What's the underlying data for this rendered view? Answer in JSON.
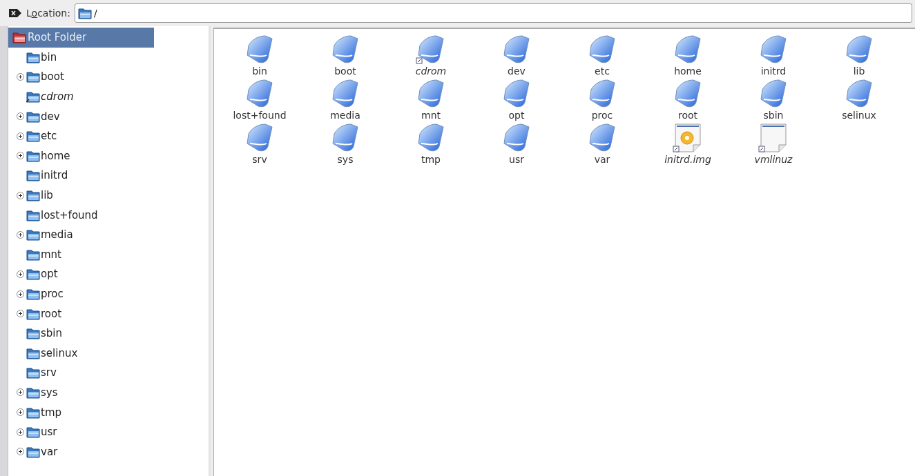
{
  "location_bar": {
    "label": [
      {
        "text": "L",
        "underlined": false
      },
      {
        "text": "o",
        "underlined": true
      },
      {
        "text": "cation:",
        "underlined": false
      }
    ],
    "value": "/"
  },
  "tree": {
    "root": {
      "label": "Root Folder",
      "selected": true,
      "children": [
        {
          "label": "bin",
          "expandable": false,
          "link": false
        },
        {
          "label": "boot",
          "expandable": true,
          "link": false
        },
        {
          "label": "cdrom",
          "expandable": false,
          "link": true
        },
        {
          "label": "dev",
          "expandable": true,
          "link": false
        },
        {
          "label": "etc",
          "expandable": true,
          "link": false
        },
        {
          "label": "home",
          "expandable": true,
          "link": false
        },
        {
          "label": "initrd",
          "expandable": false,
          "link": false
        },
        {
          "label": "lib",
          "expandable": true,
          "link": false
        },
        {
          "label": "lost+found",
          "expandable": false,
          "link": false
        },
        {
          "label": "media",
          "expandable": true,
          "link": false
        },
        {
          "label": "mnt",
          "expandable": false,
          "link": false
        },
        {
          "label": "opt",
          "expandable": true,
          "link": false
        },
        {
          "label": "proc",
          "expandable": true,
          "link": false
        },
        {
          "label": "root",
          "expandable": true,
          "link": false
        },
        {
          "label": "sbin",
          "expandable": false,
          "link": false
        },
        {
          "label": "selinux",
          "expandable": false,
          "link": false
        },
        {
          "label": "srv",
          "expandable": false,
          "link": false
        },
        {
          "label": "sys",
          "expandable": true,
          "link": false
        },
        {
          "label": "tmp",
          "expandable": true,
          "link": false
        },
        {
          "label": "usr",
          "expandable": true,
          "link": false
        },
        {
          "label": "var",
          "expandable": true,
          "link": false
        }
      ]
    }
  },
  "files": [
    {
      "name": "bin",
      "kind": "folder",
      "link": false
    },
    {
      "name": "boot",
      "kind": "folder",
      "link": false
    },
    {
      "name": "cdrom",
      "kind": "folder",
      "link": true
    },
    {
      "name": "dev",
      "kind": "folder",
      "link": false
    },
    {
      "name": "etc",
      "kind": "folder",
      "link": false
    },
    {
      "name": "home",
      "kind": "folder",
      "link": false
    },
    {
      "name": "initrd",
      "kind": "folder",
      "link": false
    },
    {
      "name": "lib",
      "kind": "folder",
      "link": false
    },
    {
      "name": "lost+found",
      "kind": "folder",
      "link": false
    },
    {
      "name": "media",
      "kind": "folder",
      "link": false
    },
    {
      "name": "mnt",
      "kind": "folder",
      "link": false
    },
    {
      "name": "opt",
      "kind": "folder",
      "link": false
    },
    {
      "name": "proc",
      "kind": "folder",
      "link": false
    },
    {
      "name": "root",
      "kind": "folder",
      "link": false
    },
    {
      "name": "sbin",
      "kind": "folder",
      "link": false
    },
    {
      "name": "selinux",
      "kind": "folder",
      "link": false
    },
    {
      "name": "srv",
      "kind": "folder",
      "link": false
    },
    {
      "name": "sys",
      "kind": "folder",
      "link": false
    },
    {
      "name": "tmp",
      "kind": "folder",
      "link": false
    },
    {
      "name": "usr",
      "kind": "folder",
      "link": false
    },
    {
      "name": "var",
      "kind": "folder",
      "link": false
    },
    {
      "name": "initrd.img",
      "kind": "disk-image",
      "link": true
    },
    {
      "name": "vmlinuz",
      "kind": "file",
      "link": true
    }
  ]
}
